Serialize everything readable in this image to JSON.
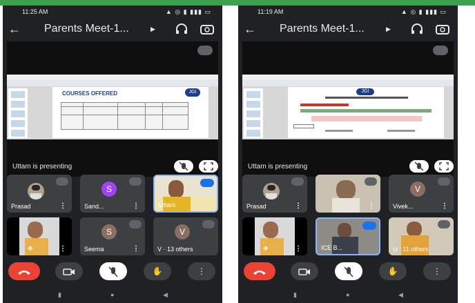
{
  "phone1": {
    "status_time": "11:25 AM",
    "status_right": "▲ ◎ ▮ ▮▮▮ ▭",
    "title": "Parents Meet-1...",
    "presenting_label": "Uttam is presenting",
    "slide_heading": "COURSES OFFERED",
    "slide_logo": "JGI",
    "tiles": [
      {
        "name": "Prasad",
        "avatar": ""
      },
      {
        "name": "Sand...",
        "avatar": "S"
      },
      {
        "name": "Uttam",
        "avatar": ""
      },
      {
        "name": "",
        "avatar": ""
      },
      {
        "name": "Seema",
        "avatar": "S"
      },
      {
        "name": "V · 13 others",
        "avatar": "V"
      }
    ]
  },
  "phone2": {
    "status_time": "11:19 AM",
    "status_right": "▲ ◎ ▮ ▮▮▮ ▭",
    "title": "Parents Meet-1...",
    "presenting_label": "Uttam is presenting",
    "slide_logo": "JGI",
    "tiles": [
      {
        "name": "Prasad",
        "avatar": ""
      },
      {
        "name": "",
        "avatar": ""
      },
      {
        "name": "Vivek...",
        "avatar": "V"
      },
      {
        "name": "",
        "avatar": ""
      },
      {
        "name": "ICE B...",
        "avatar": ""
      },
      {
        "name": "U · 11 others",
        "avatar": ""
      }
    ]
  },
  "icons": [
    "back-arrow-icon",
    "headphones-icon",
    "switch-camera-icon",
    "mic-off-icon",
    "fullscreen-icon",
    "end-call-icon",
    "video-icon",
    "raise-hand-icon",
    "more-icon"
  ],
  "colors": {
    "background": "#202124",
    "tile": "#3c4043",
    "end_call": "#ea4335",
    "accent": "#1a73e8",
    "avatar_purple": "#a142f4",
    "avatar_brown": "#8d6e63"
  }
}
